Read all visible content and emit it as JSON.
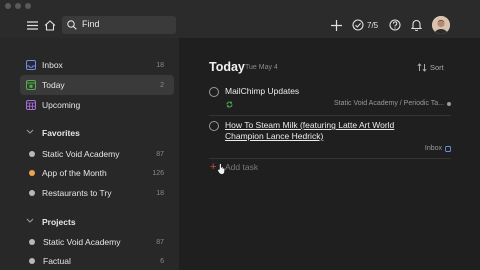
{
  "topbar": {
    "search_placeholder": "Find",
    "karma": "7/5"
  },
  "sidebar": {
    "views": [
      {
        "label": "Inbox",
        "count": "18",
        "icon": "inbox-icon"
      },
      {
        "label": "Today",
        "count": "2",
        "icon": "calendar-today-icon"
      },
      {
        "label": "Upcoming",
        "count": "",
        "icon": "calendar-upcoming-icon"
      }
    ],
    "favorites_header": "Favorites",
    "favorites": [
      {
        "label": "Static Void Academy",
        "count": "87",
        "color": "#b8b8b8"
      },
      {
        "label": "App of the Month",
        "count": "126",
        "color": "#f0a34d"
      },
      {
        "label": "Restaurants to Try",
        "count": "18",
        "color": "#b8b8b8"
      }
    ],
    "projects_header": "Projects",
    "projects": [
      {
        "label": "Static Void Academy",
        "count": "87",
        "color": "#b8b8b8"
      },
      {
        "label": "Factual",
        "count": "6",
        "color": "#b8b8b8"
      }
    ]
  },
  "main": {
    "title": "Today",
    "date": "Tue May 4",
    "sort_label": "Sort",
    "tasks": [
      {
        "name": "MailChimp Updates",
        "project": "Static Void Academy / Periodic Ta..."
      },
      {
        "name": "How To Steam Milk (featuring Latte Art World Champion Lance Hedrick)",
        "project": "Inbox"
      }
    ],
    "add_task": "Add task"
  },
  "colors": {
    "accent": "#d24b3f",
    "sidebar_bg": "#282828",
    "main_bg": "#1f1f1f"
  }
}
